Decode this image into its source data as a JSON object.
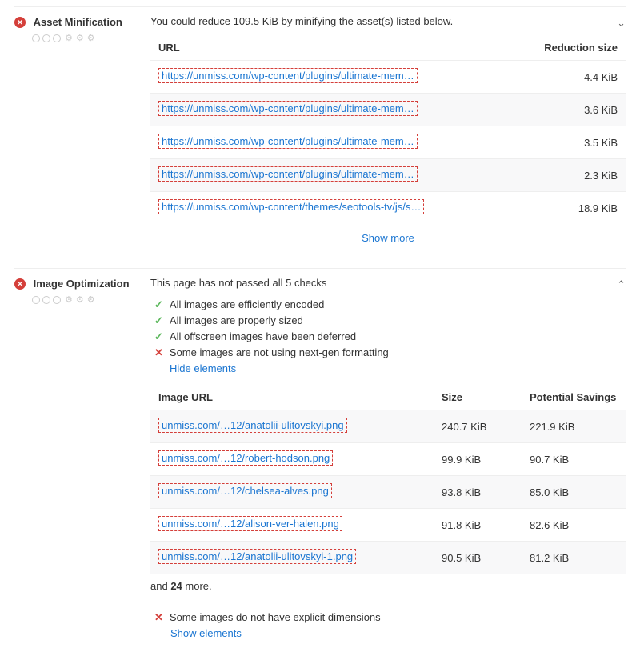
{
  "sections": {
    "asset_minification": {
      "title": "Asset Minification",
      "intro": "You could reduce 109.5 KiB by minifying the asset(s) listed below.",
      "th_url": "URL",
      "th_reduction": "Reduction size",
      "rows": [
        {
          "url": "https://unmiss.com/wp-content/plugins/ultimate-mem…",
          "size": "4.4 KiB"
        },
        {
          "url": "https://unmiss.com/wp-content/plugins/ultimate-mem…",
          "size": "3.6 KiB"
        },
        {
          "url": "https://unmiss.com/wp-content/plugins/ultimate-mem…",
          "size": "3.5 KiB"
        },
        {
          "url": "https://unmiss.com/wp-content/plugins/ultimate-mem…",
          "size": "2.3 KiB"
        },
        {
          "url": "https://unmiss.com/wp-content/themes/seotools-tv/js/s…",
          "size": "18.9 KiB"
        }
      ],
      "show_more": "Show more"
    },
    "image_optimization": {
      "title": "Image Optimization",
      "intro": "This page has not passed all 5 checks",
      "checks": [
        {
          "pass": true,
          "text": "All images are efficiently encoded"
        },
        {
          "pass": true,
          "text": "All images are properly sized"
        },
        {
          "pass": true,
          "text": "All offscreen images have been deferred"
        },
        {
          "pass": false,
          "text": "Some images are not using next-gen formatting"
        }
      ],
      "hide_elements": "Hide elements",
      "th_url": "Image URL",
      "th_size": "Size",
      "th_savings": "Potential Savings",
      "rows": [
        {
          "url": "unmiss.com/…12/anatolii-ulitovskyi.png",
          "size": "240.7 KiB",
          "savings": "221.9 KiB"
        },
        {
          "url": "unmiss.com/…12/robert-hodson.png",
          "size": "99.9 KiB",
          "savings": "90.7 KiB"
        },
        {
          "url": "unmiss.com/…12/chelsea-alves.png",
          "size": "93.8 KiB",
          "savings": "85.0 KiB"
        },
        {
          "url": "unmiss.com/…12/alison-ver-halen.png",
          "size": "91.8 KiB",
          "savings": "82.6 KiB"
        },
        {
          "url": "unmiss.com/…12/anatolii-ulitovskyi-1.png",
          "size": "90.5 KiB",
          "savings": "81.2 KiB"
        }
      ],
      "and_more_prefix": "and ",
      "and_more_count": "24",
      "and_more_suffix": " more.",
      "sub_check": "Some images do not have explicit dimensions",
      "show_elements": "Show elements"
    }
  }
}
